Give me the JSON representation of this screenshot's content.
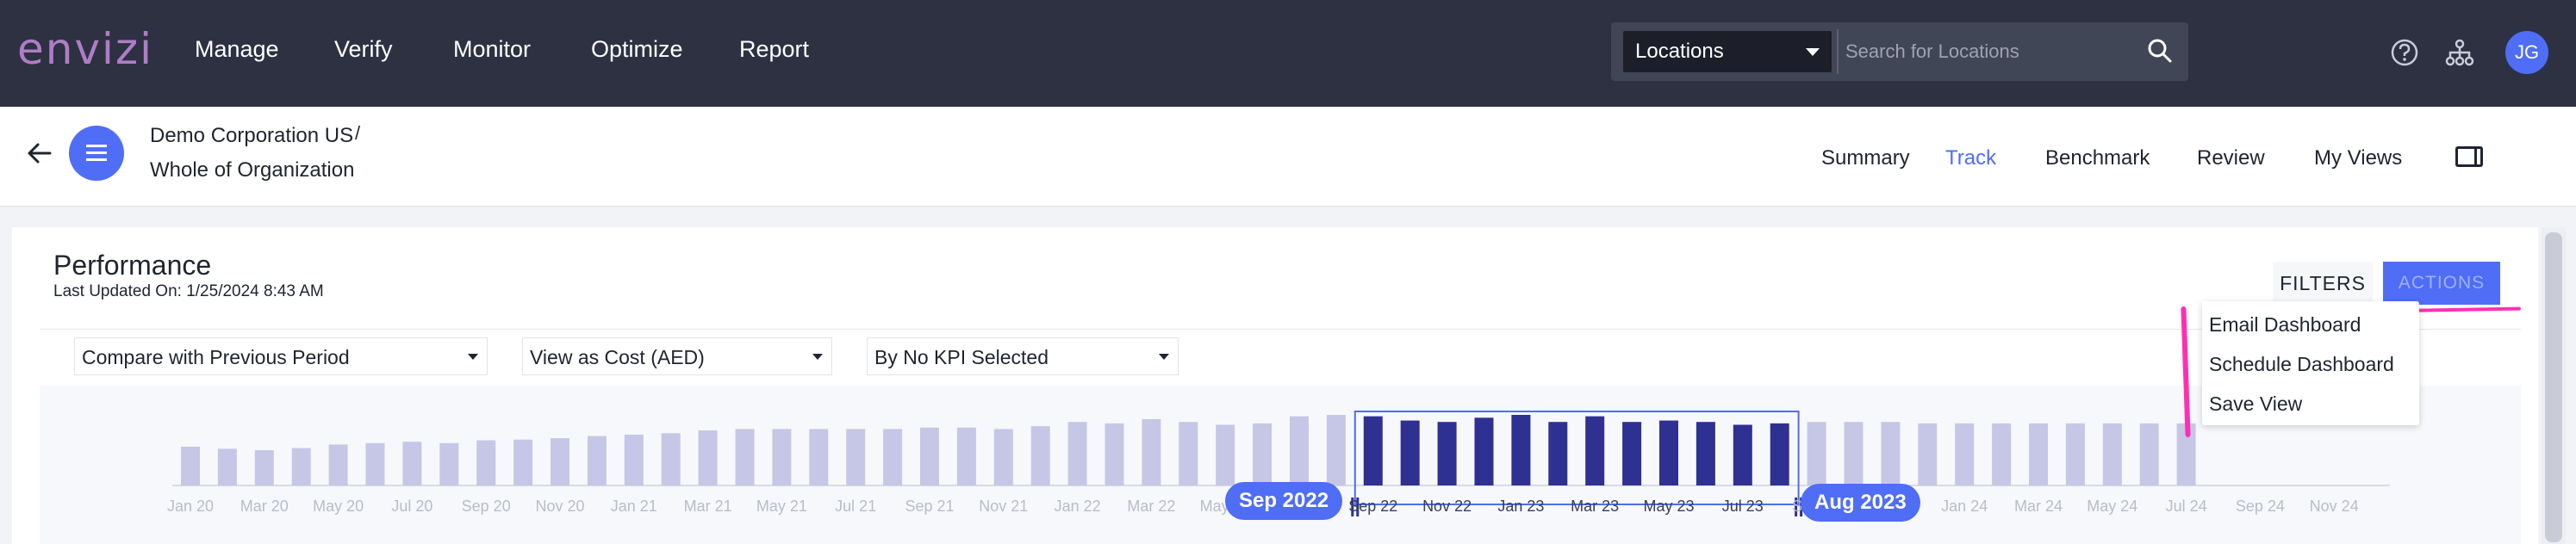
{
  "app": {
    "logo": "envizi",
    "nav": [
      "Manage",
      "Verify",
      "Monitor",
      "Optimize",
      "Report"
    ],
    "location_select": "Locations",
    "search_placeholder": "Search for Locations",
    "user_initials": "JG"
  },
  "breadcrumb": {
    "org": "Demo Corporation US",
    "separator": "/",
    "scope": "Whole of Organization"
  },
  "view_tabs": [
    "Summary",
    "Track",
    "Benchmark",
    "Review",
    "My Views"
  ],
  "active_tab": "Track",
  "performance": {
    "title": "Performance",
    "last_updated": "Last Updated On: 1/25/2024 8:43 AM",
    "filters_label": "FILTERS",
    "actions_label": "ACTIONS",
    "actions_menu": [
      "Email Dashboard",
      "Schedule Dashboard",
      "Save View"
    ],
    "dropdowns": [
      "Compare with Previous Period",
      "View as Cost (AED)",
      "By No KPI Selected"
    ]
  },
  "colors": {
    "accent": "#4f6df5",
    "topbar": "#2d3142",
    "bar_selected": "#2e3192",
    "bar_unselected": "#c6c7e6",
    "annotation": "#ff2fb3"
  },
  "chart_data": {
    "type": "bar",
    "categories": [
      "Jan 20",
      "Feb 20",
      "Mar 20",
      "Apr 20",
      "May 20",
      "Jun 20",
      "Jul 20",
      "Aug 20",
      "Sep 20",
      "Oct 20",
      "Nov 20",
      "Dec 20",
      "Jan 21",
      "Feb 21",
      "Mar 21",
      "Apr 21",
      "May 21",
      "Jun 21",
      "Jul 21",
      "Aug 21",
      "Sep 21",
      "Oct 21",
      "Nov 21",
      "Dec 21",
      "Jan 22",
      "Feb 22",
      "Mar 22",
      "Apr 22",
      "May 22",
      "Jun 22",
      "Jul 22",
      "Aug 22",
      "Sep 22",
      "Oct 22",
      "Nov 22",
      "Dec 22",
      "Jan 23",
      "Feb 23",
      "Mar 23",
      "Apr 23",
      "May 23",
      "Jun 23",
      "Jul 23",
      "Aug 23",
      "Sep 23",
      "Oct 23",
      "Nov 23",
      "Dec 23",
      "Jan 24",
      "Feb 24",
      "Mar 24",
      "Apr 24",
      "May 24",
      "Jun 24",
      "Jul 24",
      "Aug 24",
      "Sep 24",
      "Oct 24",
      "Nov 24",
      "Dec 24"
    ],
    "values": [
      0.55,
      0.52,
      0.5,
      0.53,
      0.58,
      0.6,
      0.62,
      0.6,
      0.64,
      0.65,
      0.67,
      0.7,
      0.72,
      0.74,
      0.78,
      0.8,
      0.8,
      0.8,
      0.8,
      0.8,
      0.82,
      0.82,
      0.8,
      0.84,
      0.9,
      0.88,
      0.94,
      0.9,
      0.86,
      0.88,
      0.98,
      1.0,
      0.98,
      0.92,
      0.9,
      0.96,
      1.0,
      0.9,
      0.98,
      0.9,
      0.92,
      0.9,
      0.86,
      0.88,
      0.9,
      0.9,
      0.9,
      0.88,
      0.88,
      0.88,
      0.88,
      0.88,
      0.88,
      0.88,
      0.88,
      null,
      null,
      null,
      null,
      null
    ],
    "tick_labels": [
      "Jan 20",
      "Mar 20",
      "May 20",
      "Jul 20",
      "Sep 20",
      "Nov 20",
      "Jan 21",
      "Mar 21",
      "May 21",
      "Jul 21",
      "Sep 21",
      "Nov 21",
      "Jan 22",
      "Mar 22",
      "May 22",
      "Jul 22",
      "Sep 22",
      "Nov 22",
      "Jan 23",
      "Mar 23",
      "May 23",
      "Jul 23",
      "Sep 23",
      "Nov 23",
      "Jan 24",
      "Mar 24",
      "May 24",
      "Jul 24",
      "Sep 24",
      "Nov 24"
    ],
    "selection_start": "Sep 2022",
    "selection_end": "Aug 2023",
    "ylim": [
      0,
      1
    ],
    "grid": false
  }
}
